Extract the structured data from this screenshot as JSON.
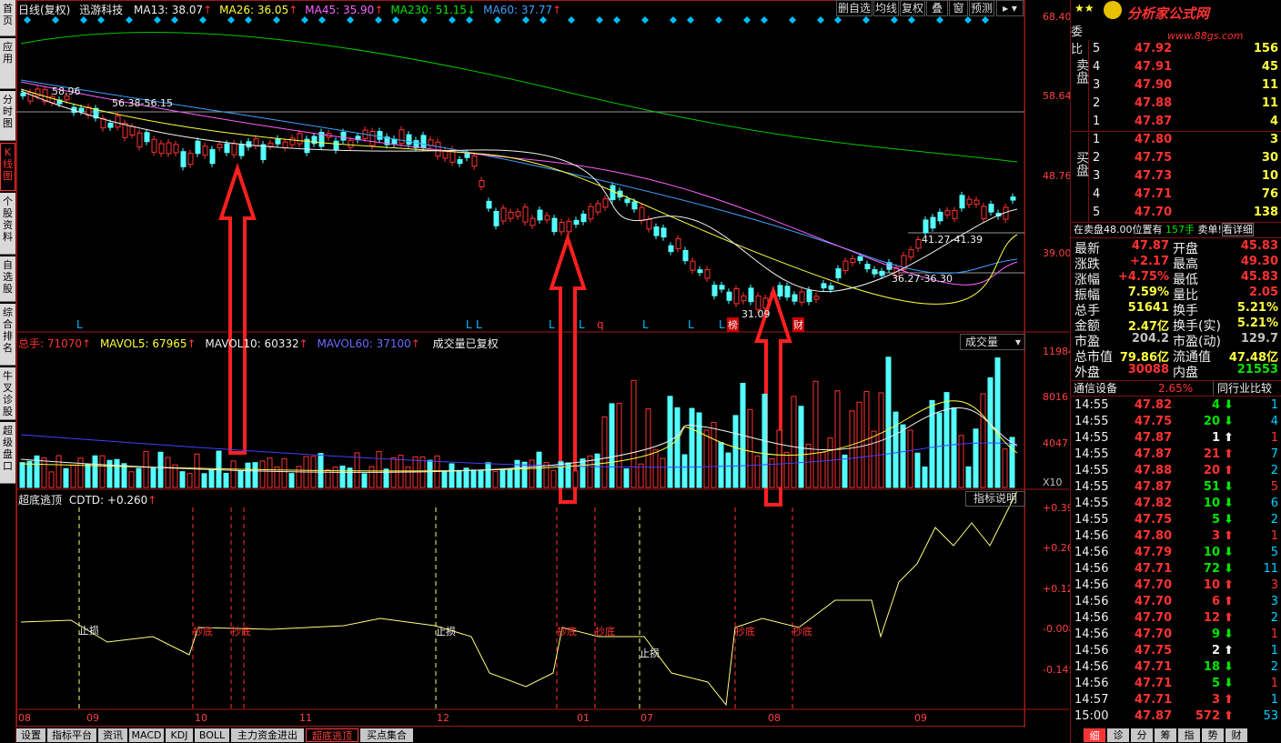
{
  "left_nav": [
    "首页",
    "应用",
    "分时图",
    "K线图",
    "个股资料",
    "自选股",
    "综合排名",
    "牛叉诊股",
    "超级盘口"
  ],
  "header": {
    "period": "日线(复权)",
    "stock_name": "迅游科技",
    "ma": [
      {
        "label": "MA13: 38.07",
        "color": "#f0f0f0"
      },
      {
        "label": "MA26: 36.05",
        "color": "#ffff40"
      },
      {
        "label": "MA45: 35.90",
        "color": "#ff60ff"
      },
      {
        "label": "MA230: 51.15",
        "color": "#00e600"
      },
      {
        "label": "MA60: 37.77",
        "color": "#40a0ff"
      }
    ],
    "buttons": [
      "删自选",
      "均线",
      "复权",
      "叠",
      "窗",
      "预测"
    ]
  },
  "price_axis": [
    "68.40",
    "58.64",
    "48.76",
    "39.00"
  ],
  "annotations": {
    "high": "58.96",
    "band1": "56.38-56.15",
    "band2": "41.27-41.39",
    "band3": "36.27-36.30",
    "low": "31.09",
    "marker_bang": "榜",
    "marker_cai": "财"
  },
  "volume": {
    "title": "总手: 71070",
    "mavol5": "MAVOL5: 67965",
    "mavol10": "MAVOL10: 60332",
    "mavol60": "MAVOL60: 37100",
    "note": "成交量已复权",
    "button": "成交量",
    "axis": [
      "11984",
      "8016",
      "4047"
    ],
    "unit": "X10"
  },
  "indicator": {
    "title": "超底逃顶",
    "value": "CDTD: +0.260",
    "button": "指标说明",
    "axis": [
      "+0.395",
      "+0.262",
      "+0.125",
      "-0.008",
      "-0.145"
    ],
    "labels": [
      "止损",
      "抄底",
      "抄底",
      "止损",
      "抄底",
      "抄底",
      "止损",
      "抄底",
      "抄底"
    ]
  },
  "time_axis": [
    "08",
    "09",
    "10",
    "11",
    "12",
    "01",
    "07",
    "08",
    "09"
  ],
  "bottom_tabs": [
    "设置",
    "指标平台",
    "资讯",
    "MACD",
    "KDJ",
    "BOLL",
    "主力资金进出",
    "超底逃顶",
    "买点集合"
  ],
  "logo": {
    "title": "分析家公式网",
    "url": "www.88gs.com"
  },
  "order_book": {
    "header_left": "委比",
    "sell_label": "卖盘",
    "buy_label": "买盘",
    "sell": [
      {
        "level": "5",
        "price": "47.92",
        "vol": "156"
      },
      {
        "level": "4",
        "price": "47.91",
        "vol": "45"
      },
      {
        "level": "3",
        "price": "47.90",
        "vol": "11"
      },
      {
        "level": "2",
        "price": "47.88",
        "vol": "11"
      },
      {
        "level": "1",
        "price": "47.87",
        "vol": "4"
      }
    ],
    "buy": [
      {
        "level": "1",
        "price": "47.80",
        "vol": "3"
      },
      {
        "level": "2",
        "price": "47.75",
        "vol": "30"
      },
      {
        "level": "3",
        "price": "47.73",
        "vol": "10"
      },
      {
        "level": "4",
        "price": "47.71",
        "vol": "76"
      },
      {
        "level": "5",
        "price": "47.70",
        "vol": "138"
      }
    ]
  },
  "order_status": {
    "text": "在卖盘48.00位置有",
    "qty": "157手",
    "tail": "卖单!",
    "link": "看详细"
  },
  "quote": [
    {
      "l1": "最新",
      "v1": "47.87",
      "c1": "red",
      "l2": "开盘",
      "v2": "45.83",
      "c2": "red"
    },
    {
      "l1": "涨跌",
      "v1": "+2.17",
      "c1": "red",
      "l2": "最高",
      "v2": "49.30",
      "c2": "red"
    },
    {
      "l1": "涨幅",
      "v1": "+4.75%",
      "c1": "red",
      "l2": "最低",
      "v2": "45.83",
      "c2": "red"
    },
    {
      "l1": "振幅",
      "v1": "7.59%",
      "c1": "yellow",
      "l2": "量比",
      "v2": "2.05",
      "c2": "red"
    },
    {
      "l1": "总手",
      "v1": "51641",
      "c1": "yellow",
      "l2": "换手",
      "v2": "5.21%",
      "c2": "yellow"
    },
    {
      "l1": "金额",
      "v1": "2.47亿",
      "c1": "yellow",
      "l2": "换手(实)",
      "v2": "5.21%",
      "c2": "yellow"
    },
    {
      "l1": "市盈",
      "v1": "204.2",
      "c1": "gray",
      "l2": "市盈(动)",
      "v2": "129.7",
      "c2": "gray"
    },
    {
      "l1": "总市值",
      "v1": "79.86亿",
      "c1": "yellow",
      "l2": "流通值",
      "v2": "47.48亿",
      "c2": "yellow"
    },
    {
      "l1": "外盘",
      "v1": "30088",
      "c1": "red",
      "l2": "内盘",
      "v2": "21553",
      "c2": "green"
    }
  ],
  "industry": {
    "name": "通信设备",
    "pct": "2.65%",
    "button": "同行业比较"
  },
  "ticks": [
    {
      "time": "14:55",
      "price": "47.82",
      "vol": "4",
      "dir": "down",
      "n": "1"
    },
    {
      "time": "14:55",
      "price": "47.75",
      "vol": "20",
      "dir": "down",
      "n": "4"
    },
    {
      "time": "14:55",
      "price": "47.87",
      "vol": "1",
      "dir": "up-w",
      "n": "1"
    },
    {
      "time": "14:55",
      "price": "47.87",
      "vol": "21",
      "dir": "up",
      "n": "7"
    },
    {
      "time": "14:55",
      "price": "47.88",
      "vol": "20",
      "dir": "up",
      "n": "2"
    },
    {
      "time": "14:55",
      "price": "47.87",
      "vol": "51",
      "dir": "down",
      "n": "5"
    },
    {
      "time": "14:55",
      "price": "47.82",
      "vol": "10",
      "dir": "down",
      "n": "6"
    },
    {
      "time": "14:55",
      "price": "47.75",
      "vol": "5",
      "dir": "down",
      "n": "2"
    },
    {
      "time": "14:56",
      "price": "47.80",
      "vol": "3",
      "dir": "up",
      "n": "1"
    },
    {
      "time": "14:56",
      "price": "47.79",
      "vol": "10",
      "dir": "down",
      "n": "5"
    },
    {
      "time": "14:56",
      "price": "47.71",
      "vol": "72",
      "dir": "down",
      "n": "11"
    },
    {
      "time": "14:56",
      "price": "47.70",
      "vol": "10",
      "dir": "up",
      "n": "3"
    },
    {
      "time": "14:56",
      "price": "47.70",
      "vol": "6",
      "dir": "up",
      "n": "3"
    },
    {
      "time": "14:56",
      "price": "47.70",
      "vol": "12",
      "dir": "up",
      "n": "2"
    },
    {
      "time": "14:56",
      "price": "47.70",
      "vol": "9",
      "dir": "down",
      "n": "1"
    },
    {
      "time": "14:56",
      "price": "47.75",
      "vol": "2",
      "dir": "up-w",
      "n": "1"
    },
    {
      "time": "14:56",
      "price": "47.71",
      "vol": "18",
      "dir": "down",
      "n": "2"
    },
    {
      "time": "14:56",
      "price": "47.71",
      "vol": "5",
      "dir": "down",
      "n": "1"
    },
    {
      "time": "14:57",
      "price": "47.71",
      "vol": "3",
      "dir": "up",
      "n": "1"
    },
    {
      "time": "15:00",
      "price": "47.87",
      "vol": "572",
      "dir": "up",
      "n": "53"
    }
  ],
  "right_tabs": [
    "细",
    "诊",
    "分",
    "筹",
    "指",
    "势",
    "财"
  ]
}
